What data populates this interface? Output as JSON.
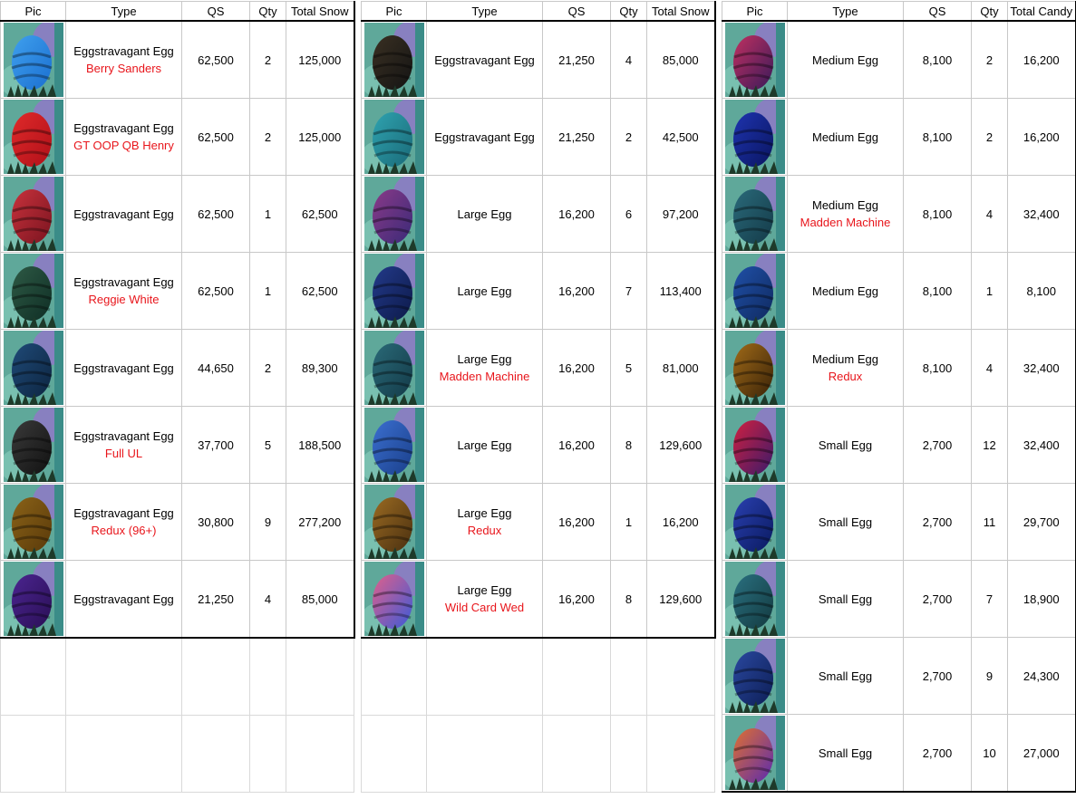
{
  "tables": [
    {
      "headers": [
        "Pic",
        "Type",
        "QS",
        "Qty",
        "Total Snow"
      ],
      "rows": [
        {
          "type": "Eggstravagant Egg",
          "sub": "Berry Sanders",
          "qs": "62,500",
          "qty": "2",
          "total": "125,000",
          "egg_icon": "blue-striped-egg-icon",
          "colors": [
            "#1b6fd0",
            "#3fa0ee"
          ]
        },
        {
          "type": "Eggstravagant Egg",
          "sub": "GT OOP QB Henry",
          "qs": "62,500",
          "qty": "2",
          "total": "125,000",
          "egg_icon": "red-crowned-egg-icon",
          "colors": [
            "#b01019",
            "#e02a2a"
          ]
        },
        {
          "type": "Eggstravagant Egg",
          "sub": "",
          "qs": "62,500",
          "qty": "1",
          "total": "62,500",
          "egg_icon": "dark-red-egg-icon",
          "colors": [
            "#7a1420",
            "#c8323c"
          ]
        },
        {
          "type": "Eggstravagant Egg",
          "sub": "Reggie White",
          "qs": "62,500",
          "qty": "1",
          "total": "62,500",
          "egg_icon": "dark-green-egg-icon",
          "colors": [
            "#0f2e25",
            "#2e5a45"
          ]
        },
        {
          "type": "Eggstravagant Egg",
          "sub": "",
          "qs": "44,650",
          "qty": "2",
          "total": "89,300",
          "egg_icon": "navy-egg-icon",
          "colors": [
            "#0d2540",
            "#1f4a78"
          ]
        },
        {
          "type": "Eggstravagant Egg",
          "sub": "Full UL",
          "qs": "37,700",
          "qty": "5",
          "total": "188,500",
          "egg_icon": "black-egg-icon",
          "colors": [
            "#111111",
            "#3a3a3a"
          ]
        },
        {
          "type": "Eggstravagant Egg",
          "sub": "Redux (96+)",
          "qs": "30,800",
          "qty": "9",
          "total": "277,200",
          "egg_icon": "brown-egg-icon",
          "colors": [
            "#5a3a0a",
            "#8a6218"
          ]
        },
        {
          "type": "Eggstravagant Egg",
          "sub": "",
          "qs": "21,250",
          "qty": "4",
          "total": "85,000",
          "egg_icon": "purple-egg-icon",
          "colors": [
            "#2a0f55",
            "#4b2590"
          ]
        }
      ]
    },
    {
      "headers": [
        "Pic",
        "Type",
        "QS",
        "Qty",
        "Total Snow"
      ],
      "rows": [
        {
          "type": "Eggstravagant Egg",
          "sub": "",
          "qs": "21,250",
          "qty": "4",
          "total": "85,000",
          "egg_icon": "black-gold-egg-icon",
          "colors": [
            "#141414",
            "#3a3022"
          ]
        },
        {
          "type": "Eggstravagant Egg",
          "sub": "",
          "qs": "21,250",
          "qty": "2",
          "total": "42,500",
          "egg_icon": "teal-egg-icon",
          "colors": [
            "#1a6a78",
            "#2fa3b0"
          ]
        },
        {
          "type": "Large Egg",
          "sub": "",
          "qs": "16,200",
          "qty": "6",
          "total": "97,200",
          "egg_icon": "purple-striped-egg-icon",
          "colors": [
            "#3a2a78",
            "#8a3a88"
          ]
        },
        {
          "type": "Large Egg",
          "sub": "",
          "qs": "16,200",
          "qty": "7",
          "total": "113,400",
          "egg_icon": "dark-blue-egg-icon",
          "colors": [
            "#0d1a4a",
            "#233a8a"
          ]
        },
        {
          "type": "Large Egg",
          "sub": "Madden Machine",
          "qs": "16,200",
          "qty": "5",
          "total": "81,000",
          "egg_icon": "madden-machine-egg-icon",
          "colors": [
            "#133a48",
            "#2a6a78"
          ]
        },
        {
          "type": "Large Egg",
          "sub": "",
          "qs": "16,200",
          "qty": "8",
          "total": "129,600",
          "egg_icon": "blue-zigzag-egg-icon",
          "colors": [
            "#1a3f8a",
            "#3b6fd0"
          ]
        },
        {
          "type": "Large Egg",
          "sub": "Redux",
          "qs": "16,200",
          "qty": "1",
          "total": "16,200",
          "egg_icon": "brown-striped-egg-icon",
          "colors": [
            "#4a3010",
            "#9a6a22"
          ]
        },
        {
          "type": "Large Egg",
          "sub": "Wild Card Wed",
          "qs": "16,200",
          "qty": "8",
          "total": "129,600",
          "egg_icon": "rainbow-egg-icon",
          "colors": [
            "#3a5ad8",
            "#e0608a"
          ]
        }
      ]
    },
    {
      "headers": [
        "Pic",
        "Type",
        "QS",
        "Qty",
        "Total Candy"
      ],
      "rows": [
        {
          "type": "Medium Egg",
          "sub": "",
          "qs": "8,100",
          "qty": "2",
          "total": "16,200",
          "egg_icon": "pink-striped-egg-icon",
          "colors": [
            "#3a1a5a",
            "#c03060"
          ]
        },
        {
          "type": "Medium Egg",
          "sub": "",
          "qs": "8,100",
          "qty": "2",
          "total": "16,200",
          "egg_icon": "royal-blue-egg-icon",
          "colors": [
            "#0a1560",
            "#1e34b0"
          ]
        },
        {
          "type": "Medium Egg",
          "sub": "Madden Machine",
          "qs": "8,100",
          "qty": "4",
          "total": "32,400",
          "egg_icon": "madden-machine-egg-icon",
          "colors": [
            "#143a48",
            "#2a6a7a"
          ]
        },
        {
          "type": "Medium Egg",
          "sub": "",
          "qs": "8,100",
          "qty": "1",
          "total": "8,100",
          "egg_icon": "blue-egg-icon",
          "colors": [
            "#0f2a60",
            "#2050a8"
          ]
        },
        {
          "type": "Medium Egg",
          "sub": "Redux",
          "qs": "8,100",
          "qty": "4",
          "total": "32,400",
          "egg_icon": "brown-striped-egg-icon",
          "colors": [
            "#3a2308",
            "#a06a18"
          ]
        },
        {
          "type": "Small Egg",
          "sub": "",
          "qs": "2,700",
          "qty": "12",
          "total": "32,400",
          "egg_icon": "red-zigzag-egg-icon",
          "colors": [
            "#3a1a6a",
            "#d02040"
          ]
        },
        {
          "type": "Small Egg",
          "sub": "",
          "qs": "2,700",
          "qty": "11",
          "total": "29,700",
          "egg_icon": "blue-zigzag-egg-icon",
          "colors": [
            "#0a1a60",
            "#2a40b0"
          ]
        },
        {
          "type": "Small Egg",
          "sub": "",
          "qs": "2,700",
          "qty": "7",
          "total": "18,900",
          "egg_icon": "teal-zigzag-egg-icon",
          "colors": [
            "#133a40",
            "#2a7080"
          ]
        },
        {
          "type": "Small Egg",
          "sub": "",
          "qs": "2,700",
          "qty": "9",
          "total": "24,300",
          "egg_icon": "navy-zigzag-egg-icon",
          "colors": [
            "#0d1e55",
            "#2a48a0"
          ]
        },
        {
          "type": "Small Egg",
          "sub": "",
          "qs": "2,700",
          "qty": "10",
          "total": "27,000",
          "egg_icon": "rainbow-zigzag-egg-icon",
          "colors": [
            "#5a2ab0",
            "#e07030"
          ]
        }
      ]
    }
  ]
}
